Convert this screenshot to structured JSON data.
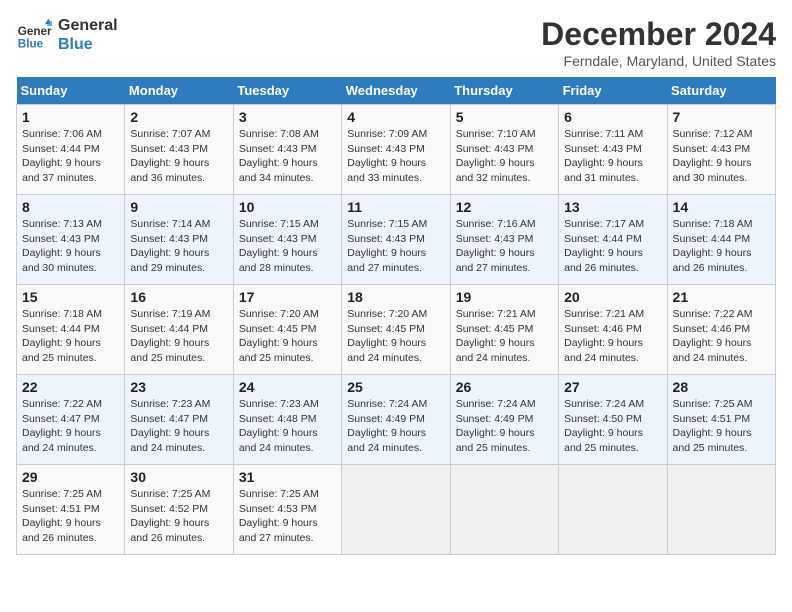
{
  "logo": {
    "line1": "General",
    "line2": "Blue"
  },
  "title": "December 2024",
  "location": "Ferndale, Maryland, United States",
  "days_of_week": [
    "Sunday",
    "Monday",
    "Tuesday",
    "Wednesday",
    "Thursday",
    "Friday",
    "Saturday"
  ],
  "weeks": [
    [
      {
        "day": 1,
        "sunrise": "Sunrise: 7:06 AM",
        "sunset": "Sunset: 4:44 PM",
        "daylight": "Daylight: 9 hours and 37 minutes."
      },
      {
        "day": 2,
        "sunrise": "Sunrise: 7:07 AM",
        "sunset": "Sunset: 4:43 PM",
        "daylight": "Daylight: 9 hours and 36 minutes."
      },
      {
        "day": 3,
        "sunrise": "Sunrise: 7:08 AM",
        "sunset": "Sunset: 4:43 PM",
        "daylight": "Daylight: 9 hours and 34 minutes."
      },
      {
        "day": 4,
        "sunrise": "Sunrise: 7:09 AM",
        "sunset": "Sunset: 4:43 PM",
        "daylight": "Daylight: 9 hours and 33 minutes."
      },
      {
        "day": 5,
        "sunrise": "Sunrise: 7:10 AM",
        "sunset": "Sunset: 4:43 PM",
        "daylight": "Daylight: 9 hours and 32 minutes."
      },
      {
        "day": 6,
        "sunrise": "Sunrise: 7:11 AM",
        "sunset": "Sunset: 4:43 PM",
        "daylight": "Daylight: 9 hours and 31 minutes."
      },
      {
        "day": 7,
        "sunrise": "Sunrise: 7:12 AM",
        "sunset": "Sunset: 4:43 PM",
        "daylight": "Daylight: 9 hours and 30 minutes."
      }
    ],
    [
      {
        "day": 8,
        "sunrise": "Sunrise: 7:13 AM",
        "sunset": "Sunset: 4:43 PM",
        "daylight": "Daylight: 9 hours and 30 minutes."
      },
      {
        "day": 9,
        "sunrise": "Sunrise: 7:14 AM",
        "sunset": "Sunset: 4:43 PM",
        "daylight": "Daylight: 9 hours and 29 minutes."
      },
      {
        "day": 10,
        "sunrise": "Sunrise: 7:15 AM",
        "sunset": "Sunset: 4:43 PM",
        "daylight": "Daylight: 9 hours and 28 minutes."
      },
      {
        "day": 11,
        "sunrise": "Sunrise: 7:15 AM",
        "sunset": "Sunset: 4:43 PM",
        "daylight": "Daylight: 9 hours and 27 minutes."
      },
      {
        "day": 12,
        "sunrise": "Sunrise: 7:16 AM",
        "sunset": "Sunset: 4:43 PM",
        "daylight": "Daylight: 9 hours and 27 minutes."
      },
      {
        "day": 13,
        "sunrise": "Sunrise: 7:17 AM",
        "sunset": "Sunset: 4:44 PM",
        "daylight": "Daylight: 9 hours and 26 minutes."
      },
      {
        "day": 14,
        "sunrise": "Sunrise: 7:18 AM",
        "sunset": "Sunset: 4:44 PM",
        "daylight": "Daylight: 9 hours and 26 minutes."
      }
    ],
    [
      {
        "day": 15,
        "sunrise": "Sunrise: 7:18 AM",
        "sunset": "Sunset: 4:44 PM",
        "daylight": "Daylight: 9 hours and 25 minutes."
      },
      {
        "day": 16,
        "sunrise": "Sunrise: 7:19 AM",
        "sunset": "Sunset: 4:44 PM",
        "daylight": "Daylight: 9 hours and 25 minutes."
      },
      {
        "day": 17,
        "sunrise": "Sunrise: 7:20 AM",
        "sunset": "Sunset: 4:45 PM",
        "daylight": "Daylight: 9 hours and 25 minutes."
      },
      {
        "day": 18,
        "sunrise": "Sunrise: 7:20 AM",
        "sunset": "Sunset: 4:45 PM",
        "daylight": "Daylight: 9 hours and 24 minutes."
      },
      {
        "day": 19,
        "sunrise": "Sunrise: 7:21 AM",
        "sunset": "Sunset: 4:45 PM",
        "daylight": "Daylight: 9 hours and 24 minutes."
      },
      {
        "day": 20,
        "sunrise": "Sunrise: 7:21 AM",
        "sunset": "Sunset: 4:46 PM",
        "daylight": "Daylight: 9 hours and 24 minutes."
      },
      {
        "day": 21,
        "sunrise": "Sunrise: 7:22 AM",
        "sunset": "Sunset: 4:46 PM",
        "daylight": "Daylight: 9 hours and 24 minutes."
      }
    ],
    [
      {
        "day": 22,
        "sunrise": "Sunrise: 7:22 AM",
        "sunset": "Sunset: 4:47 PM",
        "daylight": "Daylight: 9 hours and 24 minutes."
      },
      {
        "day": 23,
        "sunrise": "Sunrise: 7:23 AM",
        "sunset": "Sunset: 4:47 PM",
        "daylight": "Daylight: 9 hours and 24 minutes."
      },
      {
        "day": 24,
        "sunrise": "Sunrise: 7:23 AM",
        "sunset": "Sunset: 4:48 PM",
        "daylight": "Daylight: 9 hours and 24 minutes."
      },
      {
        "day": 25,
        "sunrise": "Sunrise: 7:24 AM",
        "sunset": "Sunset: 4:49 PM",
        "daylight": "Daylight: 9 hours and 24 minutes."
      },
      {
        "day": 26,
        "sunrise": "Sunrise: 7:24 AM",
        "sunset": "Sunset: 4:49 PM",
        "daylight": "Daylight: 9 hours and 25 minutes."
      },
      {
        "day": 27,
        "sunrise": "Sunrise: 7:24 AM",
        "sunset": "Sunset: 4:50 PM",
        "daylight": "Daylight: 9 hours and 25 minutes."
      },
      {
        "day": 28,
        "sunrise": "Sunrise: 7:25 AM",
        "sunset": "Sunset: 4:51 PM",
        "daylight": "Daylight: 9 hours and 25 minutes."
      }
    ],
    [
      {
        "day": 29,
        "sunrise": "Sunrise: 7:25 AM",
        "sunset": "Sunset: 4:51 PM",
        "daylight": "Daylight: 9 hours and 26 minutes."
      },
      {
        "day": 30,
        "sunrise": "Sunrise: 7:25 AM",
        "sunset": "Sunset: 4:52 PM",
        "daylight": "Daylight: 9 hours and 26 minutes."
      },
      {
        "day": 31,
        "sunrise": "Sunrise: 7:25 AM",
        "sunset": "Sunset: 4:53 PM",
        "daylight": "Daylight: 9 hours and 27 minutes."
      },
      null,
      null,
      null,
      null
    ]
  ]
}
